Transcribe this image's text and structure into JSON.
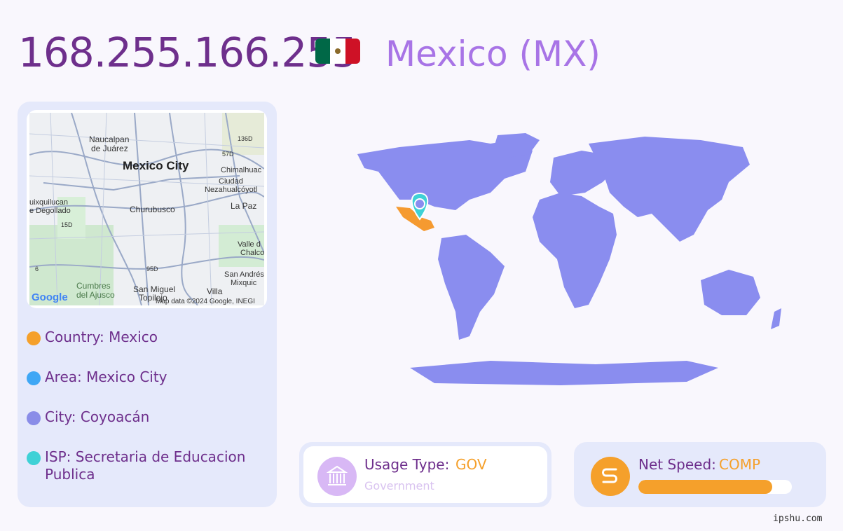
{
  "header": {
    "ip": "168.255.166.255",
    "country": "Mexico (MX)",
    "flag_colors": [
      "#006847",
      "#ffffff",
      "#ce1126"
    ]
  },
  "map": {
    "labels": [
      "Naucalpan",
      "de Juárez",
      "Mexico City",
      "Chimalhuac",
      "Ciudad",
      "Nezahualcóyotl",
      "uixquilucan",
      "e Degollado",
      "Churubusco",
      "La Paz",
      "Valle d",
      "Chalco",
      "San Andrés",
      "Mixquic",
      "Cumbres",
      "del Ajusco",
      "San Miguel",
      "Topilejo",
      "Villa",
      "136D",
      "57D",
      "15D",
      "95D",
      "6"
    ],
    "logo": "Google",
    "attribution": "Map data ©2024 Google, INEGI"
  },
  "legend": [
    {
      "label": "Country: Mexico",
      "color": "#f5a02b"
    },
    {
      "label": "Area: Mexico City",
      "color": "#3fa7f5"
    },
    {
      "label": "City: Coyoacán",
      "color": "#8a8de8"
    },
    {
      "label": "ISP: Secretaria de Educacion Publica",
      "color": "#3fd1d6"
    }
  ],
  "usage": {
    "label": "Usage Type:",
    "value": "GOV",
    "sub": "Government",
    "icon": "government-building-icon"
  },
  "speed": {
    "label": "Net Speed:",
    "value": "COMP",
    "progress": 0.87,
    "icon": "speed-icon"
  },
  "watermark": "ipshu.com",
  "world": {
    "land_color": "#8a8def",
    "highlight_color": "#f59a30",
    "pin_color": "#3fd1d6"
  }
}
